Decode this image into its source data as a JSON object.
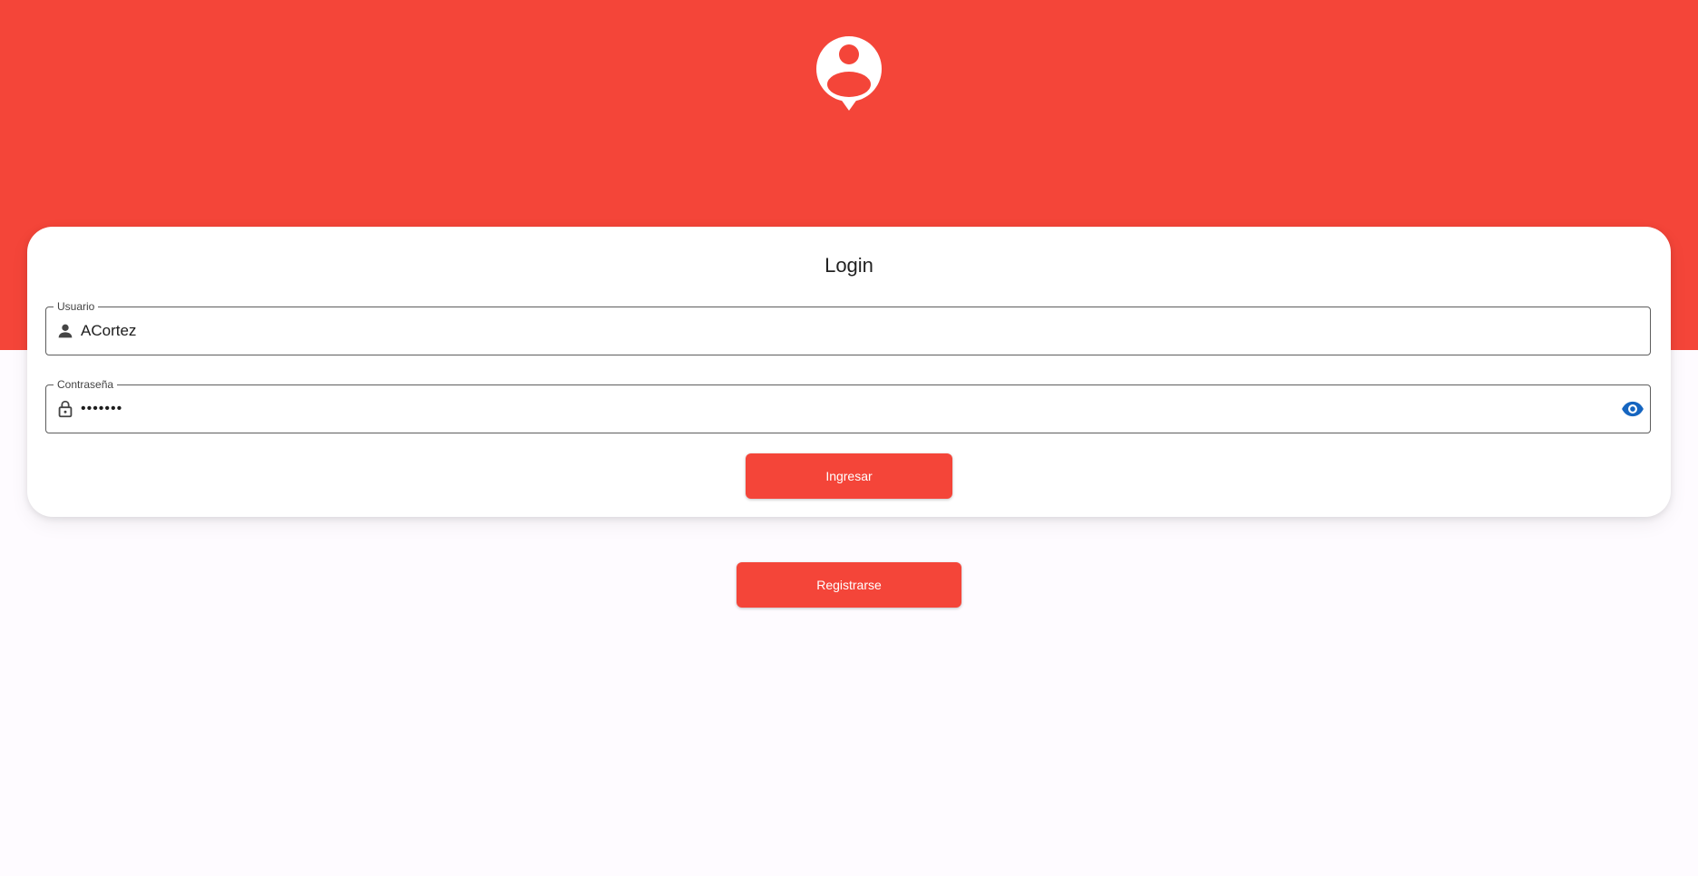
{
  "colors": {
    "brand": "#f44539",
    "background": "#fefbff",
    "card": "#ffffff",
    "field_border": "#5d5d5d",
    "eye_icon": "#1565c0"
  },
  "header": {
    "logo_icon": "user-location-icon"
  },
  "login_card": {
    "title": "Login",
    "username": {
      "label": "Usuario",
      "value": "ACortez",
      "icon": "person-icon"
    },
    "password": {
      "label": "Contraseña",
      "value": "•••••••",
      "icon": "lock-icon",
      "toggle_icon": "eye-icon"
    },
    "submit_label": "Ingresar"
  },
  "register_label": "Registrarse"
}
